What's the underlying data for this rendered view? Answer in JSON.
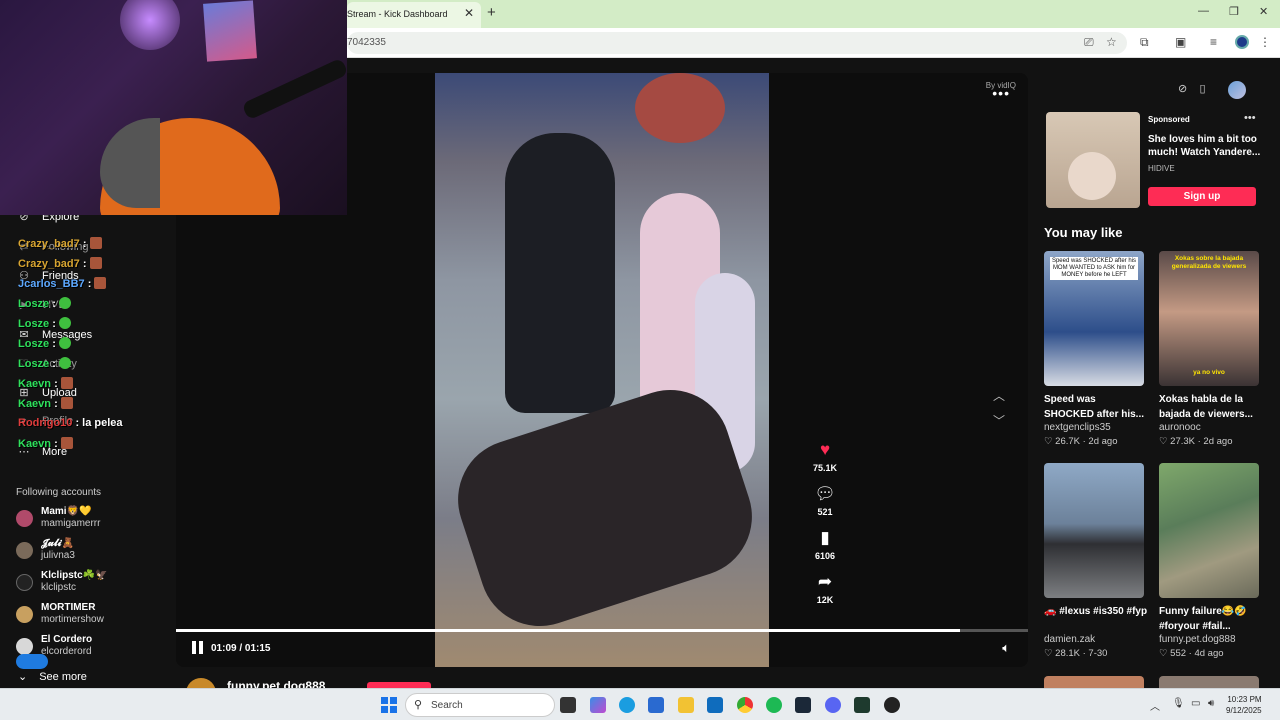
{
  "browser": {
    "tab_title": "Stream - Kick Dashboard",
    "tab_close": "✕",
    "new_tab": "+",
    "url_fragment": "7042335",
    "minimize": "—",
    "restore": "❐",
    "close": "✕"
  },
  "leftnav": {
    "items": [
      {
        "label": "Explore",
        "icon": "compass-icon"
      },
      {
        "label": "Following",
        "icon": "following-icon"
      },
      {
        "label": "Friends",
        "icon": "friends-icon"
      },
      {
        "label": "LIVE",
        "icon": "live-icon"
      },
      {
        "label": "Messages",
        "icon": "messages-icon"
      },
      {
        "label": "Activity",
        "icon": "activity-icon"
      },
      {
        "label": "Upload",
        "icon": "upload-icon"
      },
      {
        "label": "Profile",
        "icon": "profile-icon"
      },
      {
        "label": "More",
        "icon": "more-icon"
      }
    ],
    "following_header": "Following accounts",
    "accounts": [
      {
        "name": "Mami🦁💛",
        "handle": "mamigamerrr"
      },
      {
        "name": "𝓙𝓾𝓵𝓲🧸",
        "handle": "julivna3"
      },
      {
        "name": "Klclipstc☘️🦅",
        "handle": "klclipstc"
      },
      {
        "name": "MORTIMER",
        "handle": "mortimershow"
      },
      {
        "name": "El Cordero",
        "handle": "elcorderord"
      }
    ],
    "see_more": "See more"
  },
  "chat": [
    {
      "user": "Crazy_bad7",
      "msg": " :",
      "color": "#d8a531"
    },
    {
      "user": "Crazy_bad7",
      "msg": " :",
      "color": "#d8a531"
    },
    {
      "user": "Jcarlos_BB7",
      "msg": " :",
      "color": "#5da8ff"
    },
    {
      "user": "Losze",
      "msg": " :",
      "color": "#2ee05c"
    },
    {
      "user": "Losze",
      "msg": " :",
      "color": "#2ee05c"
    },
    {
      "user": "Losze",
      "msg": " :",
      "color": "#2ee05c"
    },
    {
      "user": "Losze",
      "msg": " :",
      "color": "#2ee05c"
    },
    {
      "user": "Kaevn",
      "msg": " :",
      "color": "#2ee05c"
    },
    {
      "user": "Kaevn",
      "msg": " :",
      "color": "#2ee05c"
    },
    {
      "user": "Rodrigo10",
      "msg": " : la pelea",
      "color": "#e03c3c"
    },
    {
      "user": "Kaevn",
      "msg": " :",
      "color": "#2ee05c"
    }
  ],
  "video": {
    "watermark": "By vidIQ",
    "more": "•••",
    "time": "01:09 / 01:15",
    "progress": 0.92,
    "likes": "75.1K",
    "comments": "521",
    "saves": "6106",
    "shares": "12K",
    "author": "funny.pet.dog888"
  },
  "sidebar": {
    "sponsored": "Sponsored",
    "ad_title": "She loves him a bit too much! Watch Yandere...",
    "ad_brand": "HIDIVE",
    "ad_cta": "Sign up",
    "you_may_like": "You may like",
    "cards": [
      {
        "title": "Speed was SHOCKED after his...",
        "author": "nextgenclips35",
        "meta": "♡ 26.7K · 2d ago",
        "caption": "Speed was SHOCKED after his MOM WANTED to ASK him for MONEY before he LEFT"
      },
      {
        "title": "Xokas habla de la bajada de viewers...",
        "author": "auronooc",
        "meta": "♡ 27.3K · 2d ago",
        "caption": "Xokas sobre la bajada generalizada de viewers",
        "caption2": "ya no vivo"
      },
      {
        "title": "🚗 #lexus #is350 #fyp",
        "author": "damien.zak",
        "meta": "♡ 28.1K · 7-30"
      },
      {
        "title": "Funny failure😂🤣 #foryour #fail...",
        "author": "funny.pet.dog888",
        "meta": "♡ 552 · 4d ago"
      }
    ]
  },
  "taskbar": {
    "search": "Search",
    "time": "10:23 PM",
    "date": "9/12/2025"
  },
  "colors": {
    "accent": "#fe2c55",
    "background": "#121212"
  }
}
